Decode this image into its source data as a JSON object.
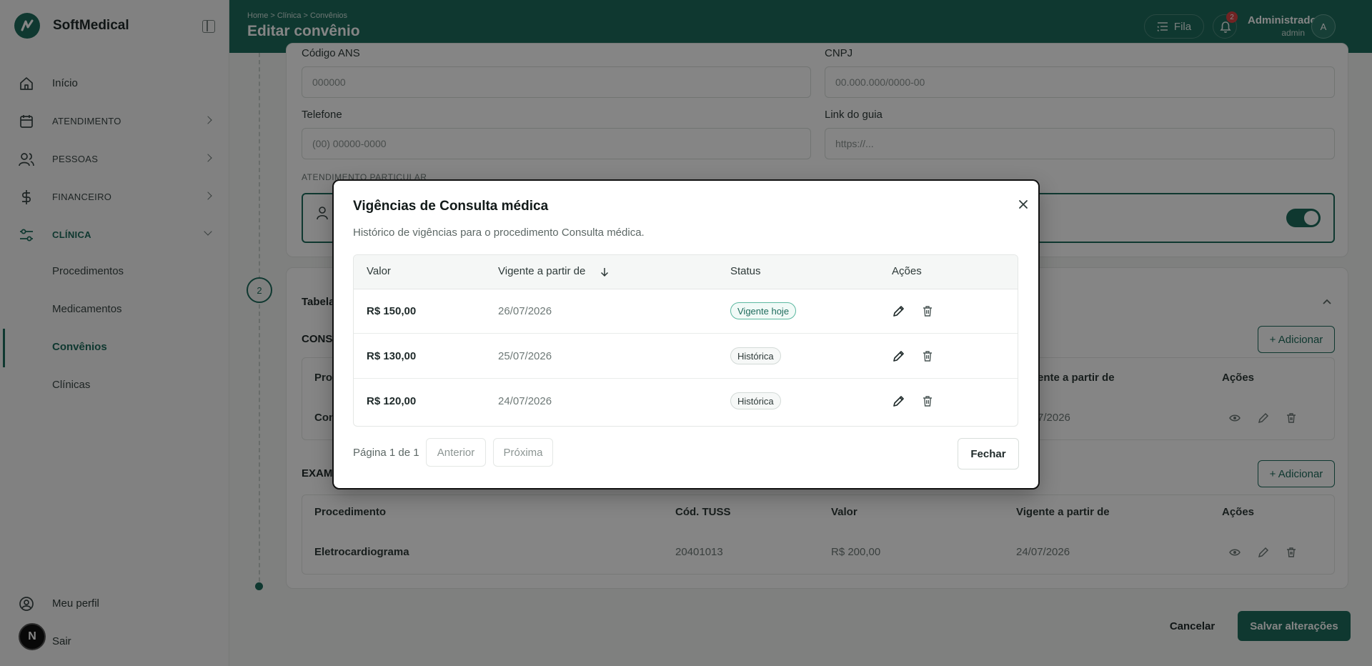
{
  "app": {
    "name": "SoftMedical"
  },
  "sidebar": {
    "items": [
      {
        "label": "Início"
      },
      {
        "label": "ATENDIMENTO"
      },
      {
        "label": "PESSOAS"
      },
      {
        "label": "FINANCEIRO"
      },
      {
        "label": "CLÍNICA"
      }
    ],
    "sub_items": [
      {
        "label": "Procedimentos"
      },
      {
        "label": "Medicamentos"
      },
      {
        "label": "Convênios"
      },
      {
        "label": "Clínicas"
      }
    ],
    "bottom": {
      "profile": "Meu perfil",
      "logout": "Sair"
    }
  },
  "topbar": {
    "breadcrumb": "Home  >  Clínica  >  Convênios",
    "title": "Editar convênio",
    "queue_label": "Fila",
    "notifications": "2",
    "user_name": "Administrador",
    "user_role": "admin",
    "avatar": "A"
  },
  "form": {
    "ans_label": "Código ANS",
    "ans_placeholder": "000000",
    "cnpj_label": "CNPJ",
    "cnpj_placeholder": "00.000.000/0000-00",
    "phone_label": "Telefone",
    "phone_placeholder": "(00) 00000-0000",
    "guide_label": "Link do guia",
    "guide_placeholder": "https://...",
    "particular_caption": "ATENDIMENTO PARTICULAR"
  },
  "stepper": {
    "step2": "2"
  },
  "tables": {
    "section_title": "Tabela",
    "consult_cap": "CONS",
    "exam_cap": "EXAM",
    "add_label": "+ Adicionar",
    "consult_head_left": "Proc",
    "consult_head_right1": "ente a partir de",
    "consult_head_right2": "Ações",
    "consult_row_left": "Con",
    "consult_row_date": "7/2026",
    "headers": [
      "Procedimento",
      "Cód. TUSS",
      "Valor",
      "Vigente a partir de",
      "Ações"
    ],
    "exam_row": [
      "Eletrocardiograma",
      "20401013",
      "R$ 200,00",
      "24/07/2026"
    ]
  },
  "footer": {
    "cancel": "Cancelar",
    "save": "Salvar alterações"
  },
  "modal": {
    "title": "Vigências de Consulta médica",
    "description": "Histórico de vigências para o procedimento Consulta médica.",
    "headers": {
      "value": "Valor",
      "date": "Vigente a partir de",
      "status": "Status",
      "actions": "Ações"
    },
    "rows": [
      {
        "value": "R$ 150,00",
        "date": "26/07/2026",
        "status": "Vigente hoje"
      },
      {
        "value": "R$ 130,00",
        "date": "25/07/2026",
        "status": "Histórica"
      },
      {
        "value": "R$ 120,00",
        "date": "24/07/2026",
        "status": "Histórica"
      }
    ],
    "pager": {
      "info": "Página 1 de 1",
      "prev": "Anterior",
      "next": "Próxima"
    },
    "close_label": "Fechar"
  },
  "misc": {
    "n_badge": "N"
  },
  "colors": {
    "brand": "#1e6b5c",
    "danger": "#d94343"
  },
  "icons": [
    "home-icon",
    "calendar-icon",
    "users-icon",
    "dollar-icon",
    "sliders-icon",
    "list-icon",
    "bell-icon",
    "user-icon",
    "close-icon",
    "pencil-icon",
    "trash-icon",
    "eye-icon",
    "arrow-down-icon",
    "chevron-up-icon"
  ]
}
